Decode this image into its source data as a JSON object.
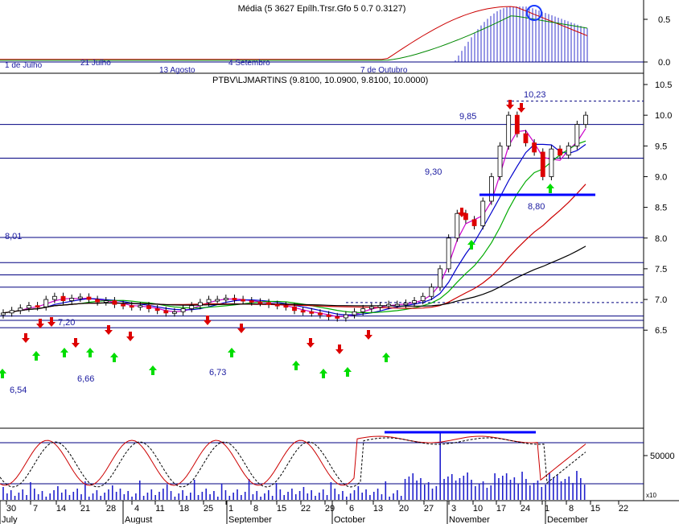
{
  "colors": {
    "background": "#ffffff",
    "grid": "#000080",
    "label": "#1a1aa0",
    "up_arrow": "#00dd00",
    "down_arrow": "#dd0000",
    "ma_fast": "#cc00cc",
    "ma_blue": "#0000cc",
    "ma_green": "#00aa00",
    "ma_red": "#cc0000",
    "ma_black": "#000000"
  },
  "chart_data": [
    {
      "type": "bar",
      "panel": "top-indicator",
      "title_overlapped": "Média (5 3627 Epílh.Trsr.Gfo 5 0.7 0.3127)",
      "ylim": [
        -0.05,
        0.7
      ],
      "y_ticks": [
        "0.5",
        "0.0"
      ],
      "y_tick_values": [
        0.5,
        0.0
      ],
      "date_labels": [
        "1 de Julho",
        "21 Julho",
        "13 Agosto",
        "4 Setembro",
        "7 de Outubro"
      ],
      "bars_start": 0.02,
      "bars_peak": 0.65
    },
    {
      "type": "candlestick",
      "panel": "price",
      "title": "PTBV\\LJMARTINS (9.8100, 10.0900, 9.8100, 10.0000)",
      "ylim": [
        6.22,
        10.7
      ],
      "y_ticks": [
        "10.5",
        "10.0",
        "9.5",
        "9.0",
        "8.5",
        "8.0",
        "7.5",
        "7.0",
        "6.5"
      ],
      "y_tick_values": [
        10.5,
        10.0,
        9.5,
        9.0,
        8.5,
        8.0,
        7.5,
        7.0,
        6.5
      ],
      "horizontal_levels": [
        9.85,
        9.3,
        8.01,
        7.6,
        7.4,
        7.2,
        6.73,
        6.66,
        6.54
      ],
      "dashed_levels": [
        10.23,
        6.95
      ],
      "annotations": [
        "10,23",
        "9,85",
        "9,30",
        "8,80",
        "8,01",
        "7,20",
        "6,66",
        "6,73",
        "6,54"
      ],
      "closes": [
        6.78,
        6.82,
        6.86,
        6.9,
        6.88,
        7.0,
        7.05,
        6.98,
        7.02,
        7.04,
        7.0,
        6.96,
        6.98,
        6.92,
        6.9,
        6.88,
        6.9,
        6.85,
        6.82,
        6.78,
        6.8,
        6.85,
        6.9,
        6.95,
        7.0,
        7.0,
        7.02,
        7.0,
        6.98,
        6.96,
        6.95,
        6.92,
        6.9,
        6.88,
        6.82,
        6.8,
        6.78,
        6.75,
        6.72,
        6.7,
        6.75,
        6.8,
        6.85,
        6.88,
        6.9,
        6.92,
        6.92,
        6.94,
        6.98,
        7.05,
        7.2,
        7.5,
        8.0,
        8.4,
        8.3,
        8.2,
        8.6,
        9.0,
        9.5,
        10.0,
        9.7,
        9.55,
        9.4,
        9.0,
        9.45,
        9.35,
        9.5,
        9.85,
        10.0
      ]
    },
    {
      "type": "line",
      "panel": "oscillator",
      "y_ticks": [
        "50000"
      ],
      "y_tick_values": [
        50000
      ],
      "scale_note": "x10",
      "x_tick_labels": [
        "30",
        "7",
        "14",
        "21",
        "28",
        "4",
        "11",
        "18",
        "25",
        "1",
        "8",
        "15",
        "22",
        "29",
        "6",
        "13",
        "20",
        "27",
        "3",
        "10",
        "17",
        "24",
        "1",
        "8",
        "15",
        "22"
      ],
      "month_labels": [
        "July",
        "August",
        "September",
        "October",
        "November",
        "December"
      ]
    }
  ]
}
